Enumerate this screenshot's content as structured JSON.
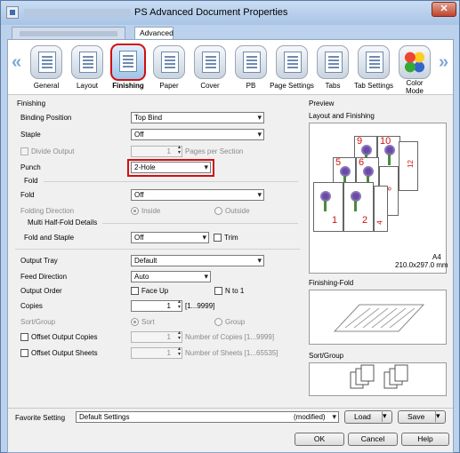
{
  "window": {
    "title": "PS Advanced Document Properties",
    "close_label": "✕"
  },
  "tabs": [
    {
      "label": ""
    },
    {
      "label": "Advanced"
    }
  ],
  "toolbar": {
    "items": [
      {
        "label": "General",
        "icon": "printer-general-icon"
      },
      {
        "label": "Layout",
        "icon": "layout-icon"
      },
      {
        "label": "Finishing",
        "icon": "finishing-icon"
      },
      {
        "label": "Paper",
        "icon": "paper-icon"
      },
      {
        "label": "Cover",
        "icon": "cover-icon"
      },
      {
        "label": "PB",
        "icon": "pb-icon"
      },
      {
        "label": "Page Settings",
        "icon": "page-settings-icon"
      },
      {
        "label": "Tabs",
        "icon": "tabs-icon"
      },
      {
        "label": "Tab Settings",
        "icon": "tab-settings-icon"
      },
      {
        "label": "Color Mode",
        "icon": "color-mode-icon"
      }
    ],
    "selected": "Finishing"
  },
  "finishing": {
    "section_label": "Finishing",
    "binding_position": {
      "label": "Binding Position",
      "value": "Top Bind"
    },
    "staple": {
      "label": "Staple",
      "value": "Off"
    },
    "divide_output": {
      "label": "Divide Output",
      "value": "1",
      "suffix": "Pages per Section"
    },
    "punch": {
      "label": "Punch",
      "value": "2-Hole"
    },
    "fold_group_label": "Fold",
    "fold": {
      "label": "Fold",
      "value": "Off"
    },
    "folding_direction": {
      "label": "Folding Direction",
      "inside": "Inside",
      "outside": "Outside"
    },
    "multi_half_fold_label": "Multi Half-Fold Details",
    "fold_and_staple": {
      "label": "Fold and Staple",
      "value": "Off",
      "trim_label": "Trim"
    }
  },
  "output": {
    "output_tray": {
      "label": "Output Tray",
      "value": "Default"
    },
    "feed_direction": {
      "label": "Feed Direction",
      "value": "Auto"
    },
    "output_order": {
      "label": "Output Order",
      "face_up": "Face Up",
      "n_to_1": "N to 1"
    },
    "copies": {
      "label": "Copies",
      "value": "1",
      "range": "[1...9999]"
    },
    "sort_group": {
      "label": "Sort/Group",
      "sort": "Sort",
      "group": "Group"
    },
    "offset_output_copies": {
      "label": "Offset Output Copies",
      "value": "1",
      "suffix": "Number of Copies [1...9999]"
    },
    "offset_output_sheets": {
      "label": "Offset Output Sheets",
      "value": "1",
      "suffix": "Number of Sheets [1...65535]"
    }
  },
  "preview": {
    "label": "Preview",
    "layout_label": "Layout and Finishing",
    "paper_size": "A4",
    "paper_dims": "210.0x297.0 mm",
    "page_numbers": [
      "9",
      "10",
      "5",
      "6",
      "1",
      "2",
      "12",
      "8",
      "4"
    ],
    "finishing_fold_label": "Finishing-Fold",
    "sort_group_label": "Sort/Group"
  },
  "favorite": {
    "label": "Favorite Setting",
    "value": "Default Settings",
    "modified": "(modified)",
    "load_label": "Load",
    "save_label": "Save"
  },
  "buttons": {
    "ok": "OK",
    "cancel": "Cancel",
    "help": "Help"
  }
}
